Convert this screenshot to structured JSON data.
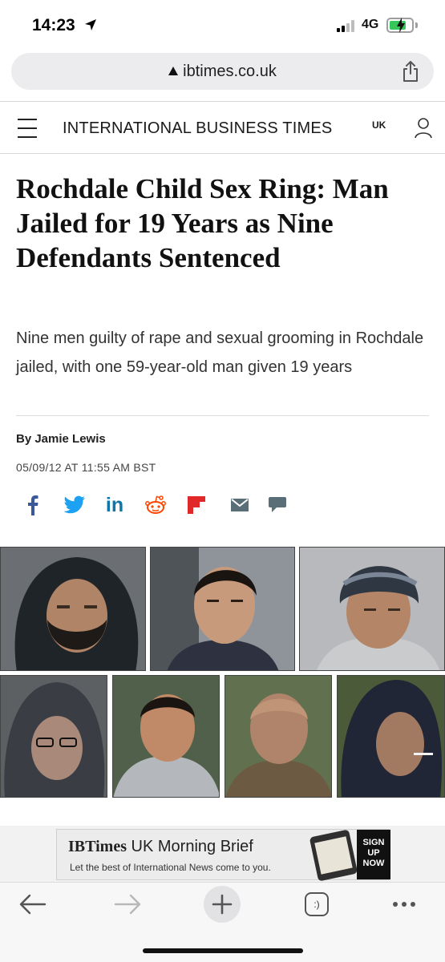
{
  "status_bar": {
    "time": "14:23",
    "network": "4G",
    "icons": [
      "location-arrow-icon",
      "signal-bars-icon",
      "battery-charging-icon"
    ]
  },
  "browser": {
    "url": "ibtimes.co.uk",
    "icons": [
      "lock-icon",
      "share-icon"
    ]
  },
  "site_header": {
    "brand": "INTERNATIONAL BUSINESS TIMES",
    "edition": "UK",
    "icons": [
      "menu-icon",
      "user-account-icon"
    ]
  },
  "article": {
    "headline": "Rochdale Child Sex Ring: Man Jailed for 19 Years as Nine Defendants Sentenced",
    "standfirst": "Nine men guilty of rape and sexual grooming in Rochdale jailed, with one 59-year-old man given 19 years",
    "author": "By Jamie Lewis",
    "date": "05/09/12 AT 11:55 AM BST",
    "share_icons": [
      "facebook-icon",
      "twitter-icon",
      "linkedin-icon",
      "reddit-icon",
      "flipboard-icon",
      "email-icon",
      "comment-icon"
    ],
    "share_colors": {
      "facebook": "#3b5998",
      "twitter": "#1da1f2",
      "linkedin": "#0e76a8",
      "reddit": "#ff4500",
      "flipboard": "#e12828",
      "email": "#5a6e78",
      "comment": "#5a6e78"
    }
  },
  "ad": {
    "brand": "IBTimes",
    "title_rest": " UK Morning Brief",
    "subtitle": "Let the best of International News come to you.",
    "cta": "SIGN UP NOW"
  },
  "toolbar": {
    "icons": [
      "back-arrow-icon",
      "forward-arrow-icon",
      "new-tab-plus-icon",
      "tabs-icon",
      "more-icon"
    ],
    "tabs_label": ":)"
  }
}
